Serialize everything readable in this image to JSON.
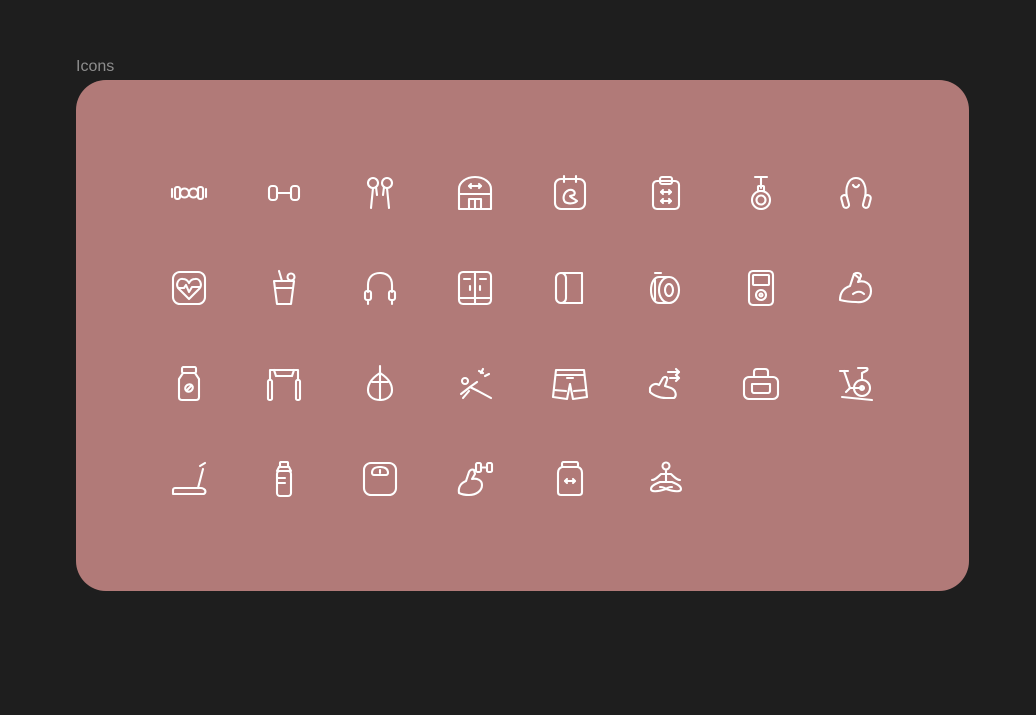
{
  "frame": {
    "label": "Icons",
    "background": "#b17a78"
  },
  "canvas": {
    "background": "#1e1e1e"
  },
  "icon_color": "#ffffff",
  "icons": [
    "barbell-icon",
    "dumbbell-icon",
    "earphones-icon",
    "gym-building-icon",
    "calendar-flex-icon",
    "clipboard-workout-icon",
    "gymnastic-ring-icon",
    "hand-grip-icon",
    "heart-rate-monitor-icon",
    "protein-drink-icon",
    "jump-rope-icon",
    "locker-icon",
    "yoga-mat-icon",
    "weight-plates-icon",
    "music-player-icon",
    "flexed-arm-icon",
    "supplement-jar-icon",
    "pull-up-bar-icon",
    "punching-bag-icon",
    "stretching-person-icon",
    "sport-shorts-icon",
    "arm-exercise-icon",
    "gym-bag-icon",
    "exercise-bike-icon",
    "treadmill-icon",
    "water-bottle-icon",
    "weighing-scale-icon",
    "arm-dumbbell-icon",
    "protein-can-icon",
    "meditation-icon"
  ]
}
